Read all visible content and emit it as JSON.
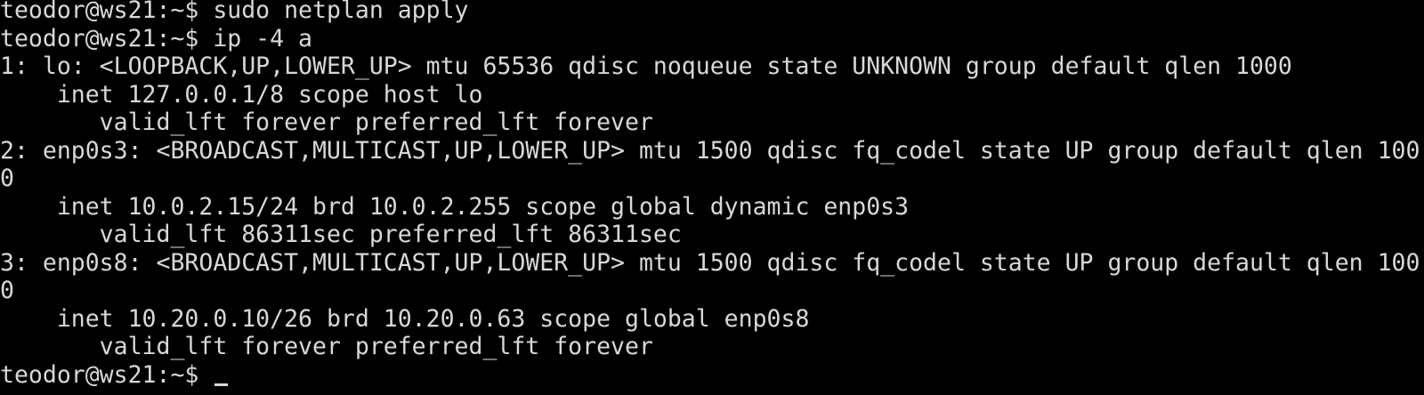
{
  "terminal": {
    "lines": [
      "teodor@ws21:~$ sudo netplan apply",
      "teodor@ws21:~$ ip -4 a",
      "1: lo: <LOOPBACK,UP,LOWER_UP> mtu 65536 qdisc noqueue state UNKNOWN group default qlen 1000",
      "    inet 127.0.0.1/8 scope host lo",
      "       valid_lft forever preferred_lft forever",
      "2: enp0s3: <BROADCAST,MULTICAST,UP,LOWER_UP> mtu 1500 qdisc fq_codel state UP group default qlen 100",
      "0",
      "    inet 10.0.2.15/24 brd 10.0.2.255 scope global dynamic enp0s3",
      "       valid_lft 86311sec preferred_lft 86311sec",
      "3: enp0s8: <BROADCAST,MULTICAST,UP,LOWER_UP> mtu 1500 qdisc fq_codel state UP group default qlen 100",
      "0",
      "    inet 10.20.0.10/26 brd 10.20.0.63 scope global enp0s8",
      "       valid_lft forever preferred_lft forever"
    ],
    "prompt": "teodor@ws21:~$ ",
    "colors": {
      "background": "#000000",
      "foreground": "#d8d8d8"
    }
  }
}
